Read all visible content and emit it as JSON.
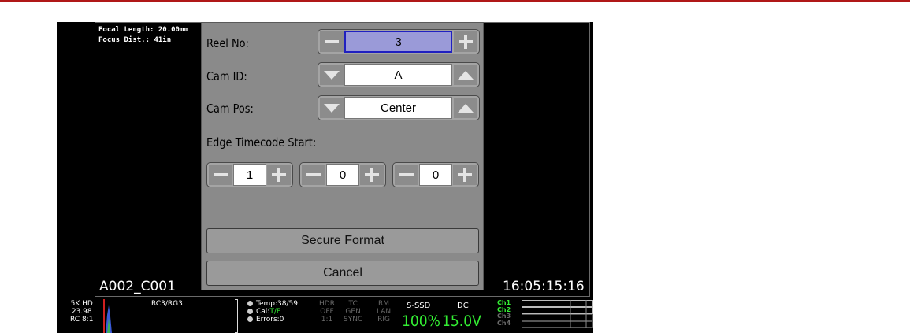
{
  "overlay": {
    "focal_length": "Focal Length: 20.00mm",
    "focus_dist": "Focus Dist.: 41in",
    "clip_name": "A002_C001",
    "timecode": "16:05:15:16"
  },
  "dialog": {
    "reel_no": {
      "label": "Reel No:",
      "value": "3"
    },
    "cam_id": {
      "label": "Cam ID:",
      "value": "A"
    },
    "cam_pos": {
      "label": "Cam Pos:",
      "value": "Center"
    },
    "edge_tc": {
      "label": "Edge Timecode Start:",
      "values": [
        "1",
        "0",
        "0"
      ]
    },
    "secure_format_label": "Secure Format",
    "cancel_label": "Cancel",
    "icons": {
      "decrement": "minus-icon",
      "increment": "plus-icon",
      "previous": "triangle-down-icon",
      "next": "triangle-up-icon"
    },
    "colors": {
      "dialog_bg": "#8a8a8a",
      "selected_field": "#9a9ad8",
      "selected_border": "#2020c0"
    }
  },
  "status": {
    "format": [
      "5K HD",
      "23.98",
      "RC 8:1"
    ],
    "color_space": "RC3/RG3",
    "temp": "Temp:38/59",
    "cal_prefix": "Cal:",
    "cal_value": "T/E",
    "errors": "Errors:0",
    "hdr": [
      "HDR",
      "OFF",
      "1:1"
    ],
    "tc": [
      "TC",
      "GEN",
      "SYNC"
    ],
    "rm": [
      "RM",
      "LAN",
      "RIG"
    ],
    "media_label": "S-SSD",
    "media_value": "100%",
    "power_label": "DC",
    "power_value": "15.0V",
    "channels": [
      "Ch1",
      "Ch2",
      "Ch3",
      "Ch4"
    ],
    "channel_active": [
      true,
      true,
      false,
      false
    ],
    "accent_green": "#33ee33"
  }
}
